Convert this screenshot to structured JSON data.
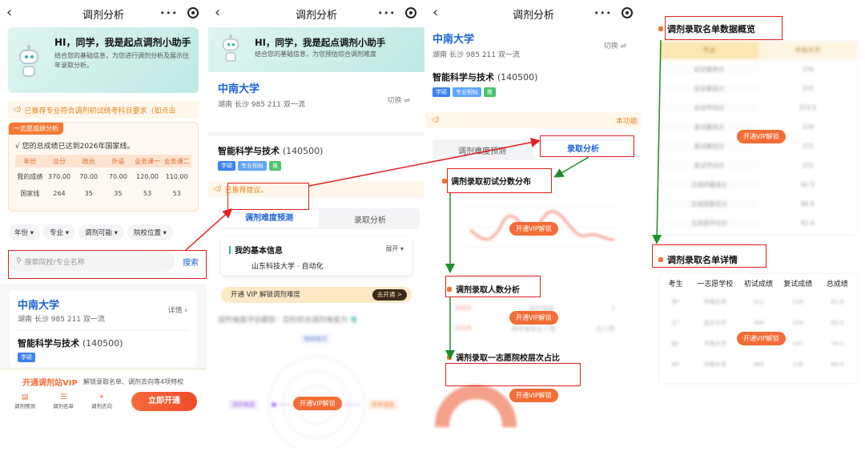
{
  "nav": {
    "title": "调剂分析",
    "more": "•••"
  },
  "banner": {
    "title": "HI，同学，我是起点调剂小助手",
    "subtitle": "结合您的基础信息，为您进行调剂分析及展示往年录取分析。",
    "subtitle2": "结合您的基础信息，为您预估综合调剂难度"
  },
  "notice1": "已推荐专业符合调剂初试统考科目要求（如点击",
  "score_card": {
    "badge": "一志愿成绩分析",
    "line": "您的总成绩已达到2026年国家线。",
    "headers": [
      "年份",
      "总分",
      "政治",
      "外语",
      "业务课一",
      "业务课二"
    ],
    "rows": [
      [
        "我的成绩",
        "370.00",
        "70.00",
        "70.00",
        "120.00",
        "110.00"
      ],
      [
        "国家线",
        "264",
        "35",
        "35",
        "53",
        "53"
      ]
    ]
  },
  "filters": [
    "年份",
    "专业",
    "调剂可能",
    "院校位置"
  ],
  "search": {
    "placeholder": "搜索院校/专业名称",
    "button": "搜索"
  },
  "school": {
    "name": "中南大学",
    "region": "湖南",
    "city": "长沙",
    "tags": "985  211  双一流",
    "detail": "详情",
    "switch": "切换",
    "major": "智能科学与技术",
    "code": "(140500)",
    "major_tags": [
      "学硕",
      "专业相似",
      "推"
    ]
  },
  "vip_bar": {
    "title": "开通调剂站VIP",
    "desc": "解锁录取名单、调剂去向等4项特权",
    "icons": [
      "调剂预测",
      "调剂名单",
      "调剂去向"
    ],
    "button": "立即开通"
  },
  "notice2": "已推荐建议。",
  "notice3": "本功能",
  "tabs": [
    "调剂难度预测",
    "录取分析"
  ],
  "basic_info": {
    "title": "我的基本信息",
    "expand": "展开",
    "value": "山东科技大学 · 自动化"
  },
  "vip_difficulty": {
    "text": "开通 VIP 解锁调剂难度",
    "btn": "去开通 >"
  },
  "difficulty_eval": "调剂难度评估模型：您的综合调剂难度为",
  "radar_labels": [
    "调剂难度",
    "院校层次",
    "竞争强度"
  ],
  "vip_unlock": "开通VIP解锁",
  "sections": [
    "调剂录取初试分数分布",
    "调剂录取人数分析",
    "调剂录取一志愿院校层次占比",
    "调剂录取名单数据概览",
    "调剂录取名单详情"
  ],
  "count_rows": [
    [
      "2025",
      "调剂录取",
      "2"
    ],
    [
      "2024",
      "调剂录取总人数",
      "总人数"
    ]
  ],
  "overview": {
    "headers": [
      "专业",
      "中南大学"
    ],
    "rows": [
      [
        "初试最高分",
        "376"
      ],
      [
        "初试最低分",
        "371"
      ],
      [
        "初试平均分",
        "373.5"
      ],
      [
        "复试最高分",
        "229"
      ],
      [
        "复试最低分",
        "215"
      ],
      [
        "复试平均分",
        "222"
      ],
      [
        "总成绩最高分",
        "82.5"
      ],
      [
        "总成绩最低分",
        "80.8"
      ],
      [
        "总成绩平均分",
        "81.6"
      ]
    ]
  },
  "detail": {
    "headers": [
      "考生",
      "一志愿学校",
      "初试成绩",
      "复试成绩",
      "总成绩"
    ],
    "rows": [
      [
        "李*",
        "华南大学",
        "411",
        "228",
        "81.8"
      ],
      [
        "王*",
        "复旦大学",
        "388",
        "224",
        "80.5"
      ],
      [
        "张*",
        "华南大学",
        "384",
        "197",
        "79.5"
      ],
      [
        "刘*",
        "华南大学",
        "389",
        "226",
        "80.4"
      ]
    ]
  },
  "colors": {
    "accent": "#1c62d6",
    "orange": "#f36d36",
    "teal": "#bfe9e3",
    "red": "#e02020",
    "arrow": "#1a8f2a"
  }
}
